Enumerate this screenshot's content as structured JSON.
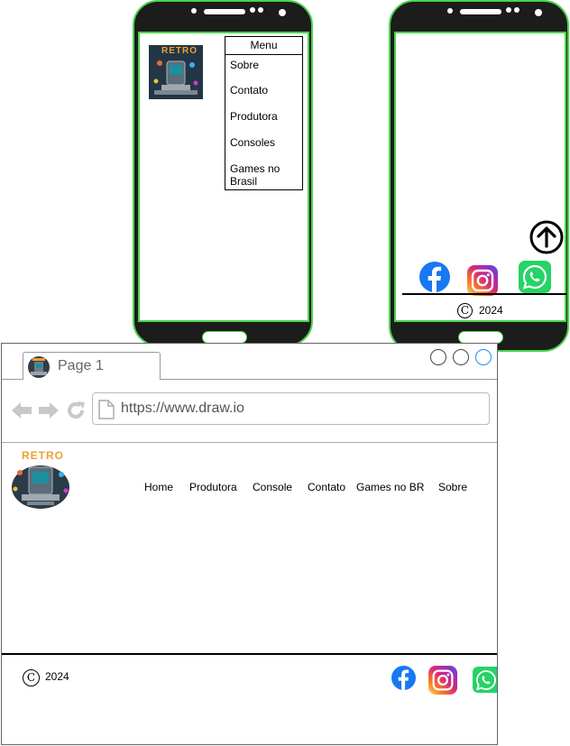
{
  "phone_menu": {
    "menu_title": "Menu",
    "items": [
      "Sobre",
      "Contato",
      "Produtora",
      "Consoles",
      "Games no Brasil"
    ]
  },
  "phone_footer": {
    "copyright_symbol": "C",
    "year": "2024",
    "icons": [
      "arrow-up-circle-icon",
      "facebook-icon",
      "instagram-icon",
      "whatsapp-icon"
    ]
  },
  "browser": {
    "tab_label": "Page 1",
    "url": "https://www.draw.io",
    "nav": [
      "Home",
      "Produtora",
      "Console",
      "Contato",
      "Games no BR",
      "Sobre"
    ],
    "footer": {
      "copyright_symbol": "C",
      "year": "2024"
    }
  },
  "logo": {
    "text": "RETRO"
  },
  "colors": {
    "phone_body": "#1c1c1c",
    "phone_outline": "#4bd34b",
    "facebook": "#1877f2",
    "whatsapp": "#25d366"
  }
}
